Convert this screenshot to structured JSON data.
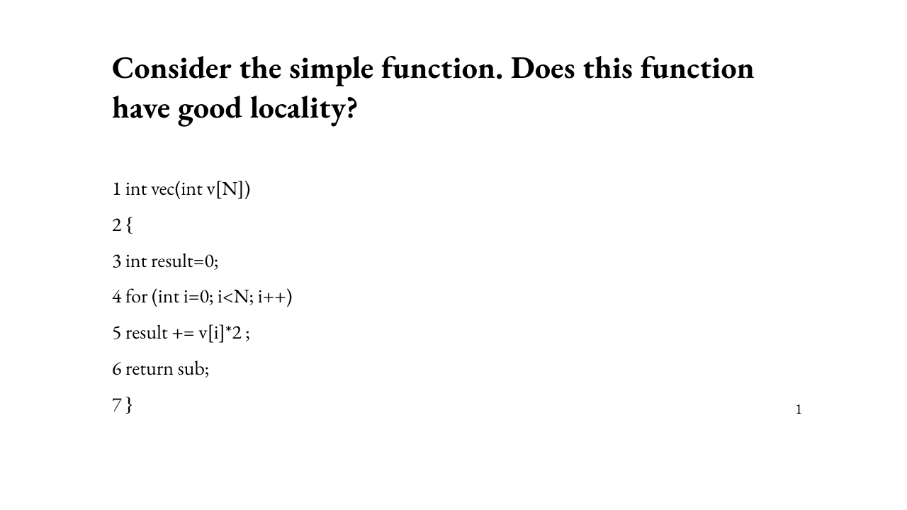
{
  "title": "Consider the simple function. Does this function have good locality?",
  "code": {
    "lines": [
      "1 int vec(int v[N])",
      "2 {",
      "3 int result=0;",
      "4 for (int i=0; i<N; i++)",
      "5 result += v[i]*2 ;",
      "6 return sub;",
      "7 }"
    ]
  },
  "page_number": "1"
}
